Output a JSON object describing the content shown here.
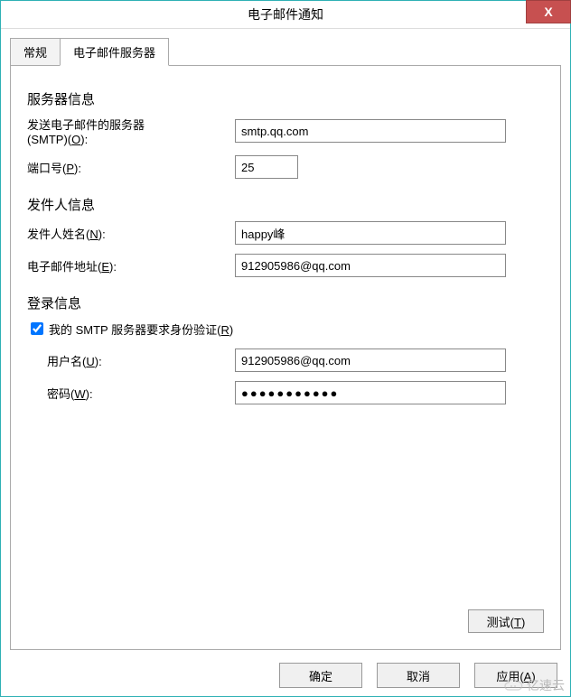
{
  "window": {
    "title": "电子邮件通知",
    "close_label": "X"
  },
  "tabs": {
    "general": "常规",
    "mailserver": "电子邮件服务器"
  },
  "server_info": {
    "heading": "服务器信息",
    "smtp_label_line1": "发送电子邮件的服务器",
    "smtp_label_line2_prefix": "(SMTP)(",
    "smtp_label_line2_key": "O",
    "smtp_label_line2_suffix": "):",
    "smtp_value": "smtp.qq.com",
    "port_label_prefix": "端口号(",
    "port_label_key": "P",
    "port_label_suffix": "):",
    "port_value": "25"
  },
  "sender_info": {
    "heading": "发件人信息",
    "name_label_prefix": "发件人姓名(",
    "name_label_key": "N",
    "name_label_suffix": "):",
    "name_value": "happy峰",
    "email_label_prefix": "电子邮件地址(",
    "email_label_key": "E",
    "email_label_suffix": "):",
    "email_value": "912905986@qq.com"
  },
  "login_info": {
    "heading": "登录信息",
    "auth_checkbox_prefix": "我的 SMTP 服务器要求身份验证(",
    "auth_checkbox_key": "R",
    "auth_checkbox_suffix": ")",
    "auth_checked": true,
    "user_label_prefix": "用户名(",
    "user_label_key": "U",
    "user_label_suffix": "):",
    "user_value": "912905986@qq.com",
    "pass_label_prefix": "密码(",
    "pass_label_key": "W",
    "pass_label_suffix": "):",
    "pass_value": "●●●●●●●●●●●"
  },
  "buttons": {
    "test_prefix": "测试(",
    "test_key": "T",
    "test_suffix": ")",
    "ok": "确定",
    "cancel": "取消",
    "apply_prefix": "应用(",
    "apply_key": "A",
    "apply_suffix": ")"
  },
  "watermark": {
    "text": "亿速云"
  }
}
